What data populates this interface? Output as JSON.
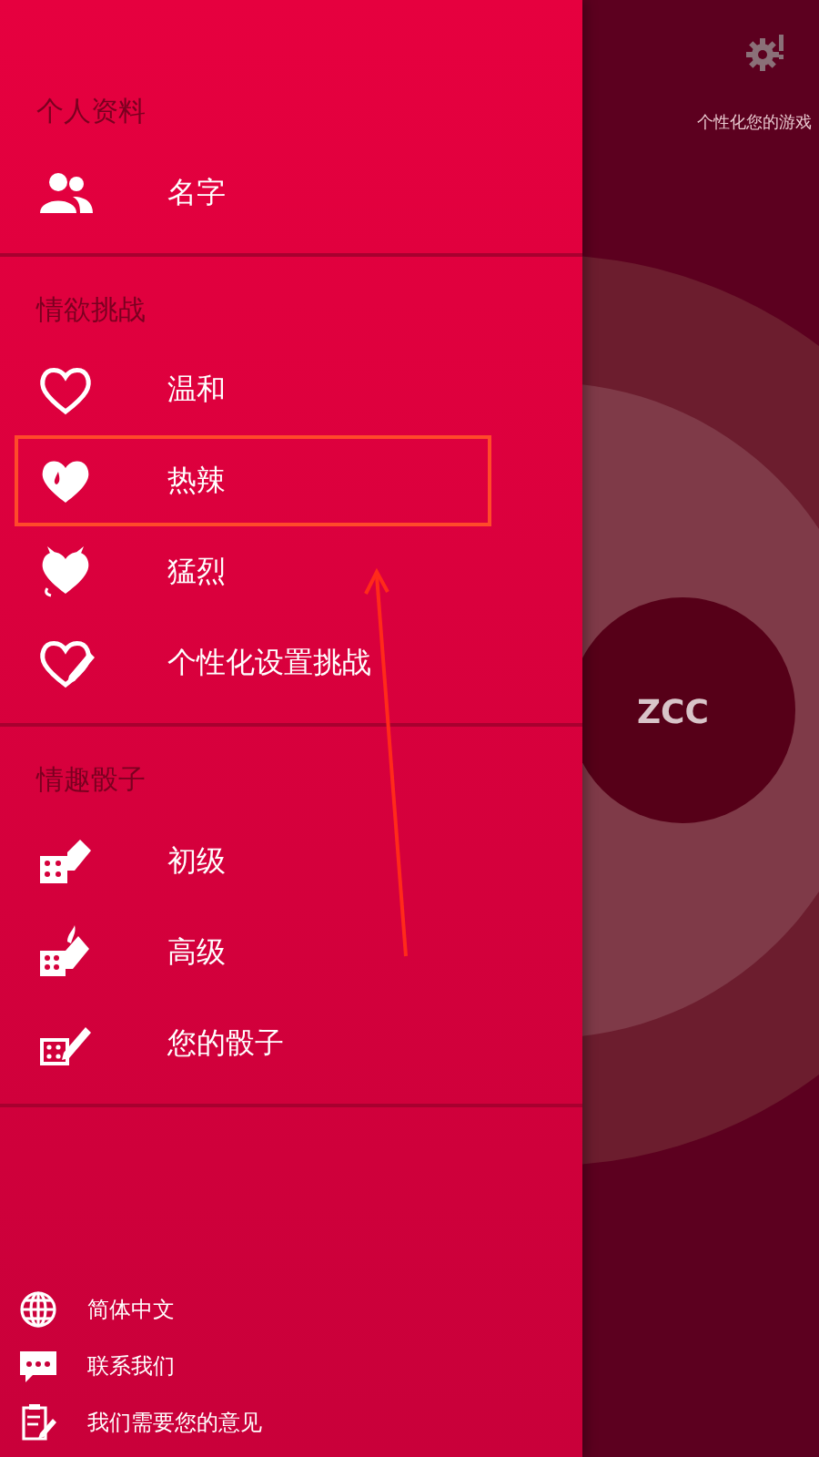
{
  "drawer": {
    "sections": [
      {
        "title": "个人资料",
        "items": [
          {
            "kind": "people",
            "label": "名字",
            "highlighted": false
          }
        ]
      },
      {
        "title": "情欲挑战",
        "items": [
          {
            "kind": "heart",
            "label": "温和",
            "highlighted": false
          },
          {
            "kind": "heart-drop",
            "label": "热辣",
            "highlighted": true
          },
          {
            "kind": "heart-horns",
            "label": "猛烈",
            "highlighted": false
          },
          {
            "kind": "heart-pencil",
            "label": "个性化设置挑战",
            "highlighted": false
          }
        ]
      },
      {
        "title": "情趣骰子",
        "items": [
          {
            "kind": "dice",
            "label": "初级",
            "highlighted": false
          },
          {
            "kind": "dice-flame",
            "label": "高级",
            "highlighted": false
          },
          {
            "kind": "dice-pencil",
            "label": "您的骰子",
            "highlighted": false
          }
        ]
      }
    ],
    "footer": [
      {
        "kind": "globe",
        "label": "简体中文"
      },
      {
        "kind": "chat",
        "label": "联系我们"
      },
      {
        "kind": "note",
        "label": "我们需要您的意见"
      }
    ]
  },
  "main": {
    "settings_label": "个性化您的游戏",
    "avatar_text": "ZCC"
  }
}
